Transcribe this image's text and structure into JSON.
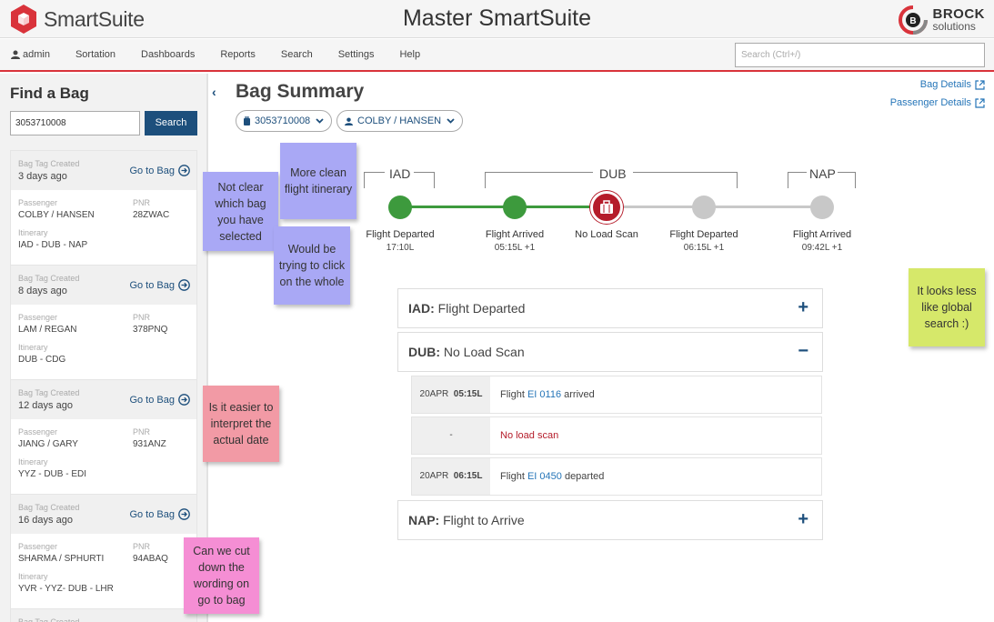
{
  "app": {
    "brand": "SmartSuite",
    "window_title": "Master SmartSuite",
    "vendor_name": "BROCK",
    "vendor_sub": "solutions",
    "brand_color": "#d9333b",
    "accent_color": "#1d4f7c"
  },
  "nav": {
    "user": "admin",
    "items": [
      "Sortation",
      "Dashboards",
      "Reports",
      "Search",
      "Settings",
      "Help"
    ],
    "search_placeholder": "Search (Ctrl+/)"
  },
  "find": {
    "title": "Find a Bag",
    "input_value": "3053710008",
    "search_label": "Search",
    "goto_label": "Go to Bag",
    "created_label": "Bag Tag Created",
    "passenger_label": "Passenger",
    "pnr_label": "PNR",
    "itinerary_label": "Itinerary",
    "results": [
      {
        "created": "3 days ago",
        "passenger": "COLBY / HANSEN",
        "pnr": "28ZWAC",
        "itinerary": "IAD - DUB - NAP"
      },
      {
        "created": "8 days ago",
        "passenger": "LAM / REGAN",
        "pnr": "378PNQ",
        "itinerary": "DUB - CDG"
      },
      {
        "created": "12 days ago",
        "passenger": "JIANG / GARY",
        "pnr": "931ANZ",
        "itinerary": "YYZ - DUB - EDI"
      },
      {
        "created": "16 days ago",
        "passenger": "SHARMA / SPHURTI",
        "pnr": "94ABAQ",
        "itinerary": "YVR - YYZ- DUB - LHR"
      },
      {
        "created": ""
      }
    ]
  },
  "summary": {
    "title": "Bag Summary",
    "bag_chip": "3053710008",
    "passenger_chip": "COLBY / HANSEN",
    "bag_details_link": "Bag Details",
    "passenger_details_link": "Passenger Details"
  },
  "timeline": {
    "airports": [
      "IAD",
      "DUB",
      "NAP"
    ],
    "steps": [
      {
        "label": "Flight Departed",
        "time": "17:10L",
        "state": "done"
      },
      {
        "label": "Flight Arrived",
        "time": "05:15L +1",
        "state": "done"
      },
      {
        "label": "No Load Scan",
        "time": "",
        "state": "alert"
      },
      {
        "label": "Flight Departed",
        "time": "06:15L +1",
        "state": "pending"
      },
      {
        "label": "Flight Arrived",
        "time": "09:42L +1",
        "state": "pending"
      }
    ],
    "colors": {
      "done": "#3d9a3d",
      "alert": "#b51c2a",
      "pending": "#c8c8c8"
    }
  },
  "accordion": [
    {
      "airport": "IAD:",
      "status": "Flight Departed",
      "toggle": "+"
    },
    {
      "airport": "DUB:",
      "status": "No Load Scan",
      "toggle": "−"
    },
    {
      "airport": "NAP:",
      "status": "Flight to Arrive",
      "toggle": "+"
    }
  ],
  "events": [
    {
      "date": "20APR",
      "time": "05:15L",
      "prefix": "Flight ",
      "flight": "EI 0116",
      "suffix": " arrived"
    },
    {
      "date": "-",
      "text": "No load scan"
    },
    {
      "date": "20APR",
      "time": "06:15L",
      "prefix": "Flight ",
      "flight": "EI 0450",
      "suffix": " departed"
    }
  ],
  "notes": [
    "Not clear which bag you have selected",
    "More clean flight itinerary",
    "Would be trying to click on the whole",
    "Is it easier to interpret the actual date",
    "Can we cut down the wording on go to bag",
    "It looks less like global search :)"
  ]
}
